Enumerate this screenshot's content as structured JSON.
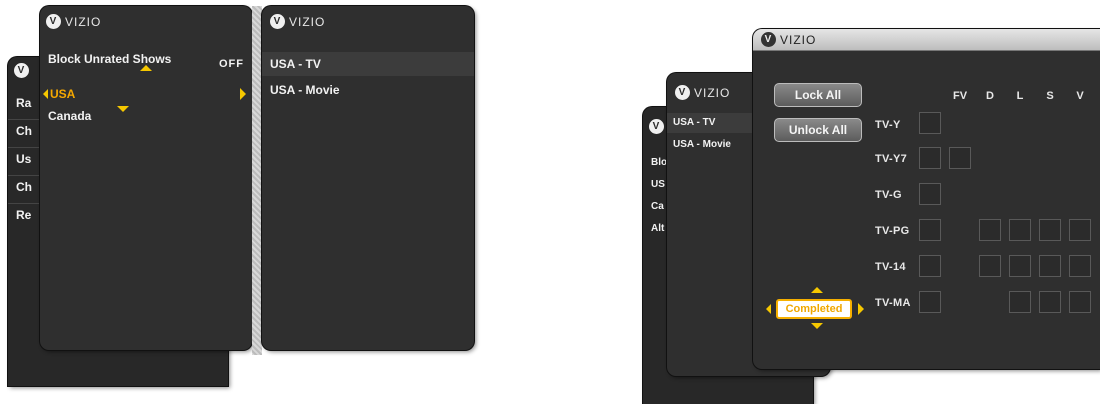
{
  "brand": "VIZIO",
  "left": {
    "back_items": [
      "Ra",
      "Ch",
      "Us",
      "Ch",
      "Re"
    ],
    "mid_items": [
      {
        "label": "Block Unrated Shows",
        "value": "OFF"
      },
      {
        "label": "USA"
      },
      {
        "label": "Canada"
      }
    ],
    "sub_items": [
      "USA - TV",
      "USA - Movie"
    ]
  },
  "right": {
    "back_items": [
      "Blo",
      "US",
      "Ca",
      "Alt"
    ],
    "sub_items": [
      "USA - TV",
      "USA - Movie"
    ],
    "buttons": {
      "lock_all": "Lock All",
      "unlock_all": "Unlock All",
      "completed": "Completed"
    },
    "columns": [
      "FV",
      "D",
      "L",
      "S",
      "V"
    ],
    "ratings": [
      "TV-Y",
      "TV-Y7",
      "TV-G",
      "TV-PG",
      "TV-14",
      "TV-MA"
    ]
  },
  "colors": {
    "accent": "#f6a800",
    "panel": "#2f2f2f"
  }
}
